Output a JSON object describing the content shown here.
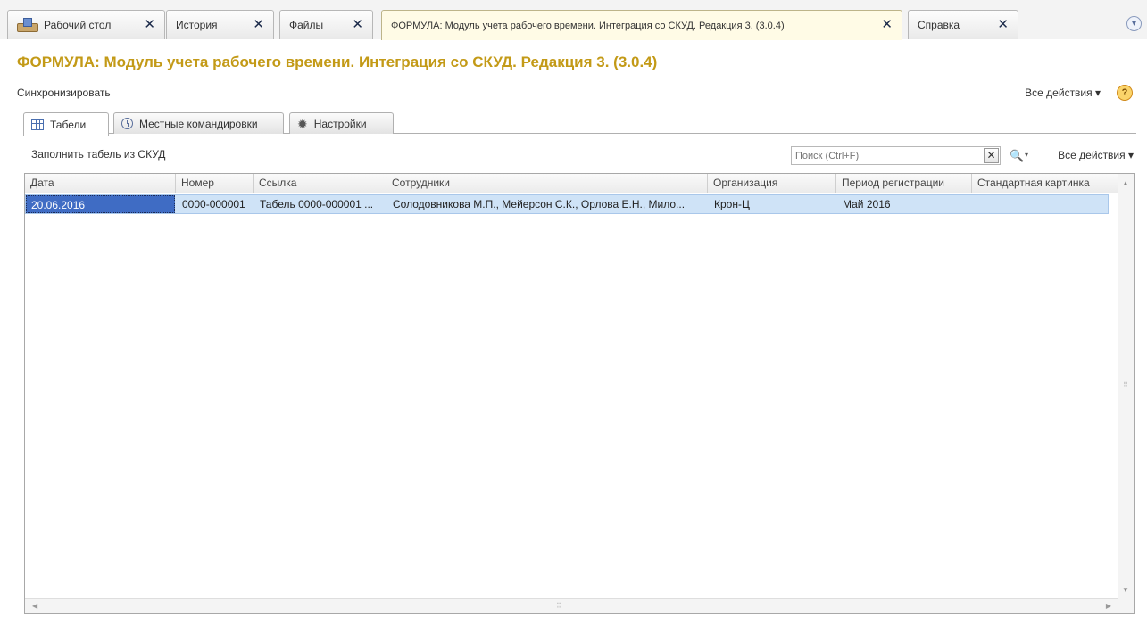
{
  "top_tabs": [
    {
      "label": "Рабочий стол",
      "close": "✕"
    },
    {
      "label": "История",
      "close": "✕"
    },
    {
      "label": "Файлы",
      "close": "✕"
    },
    {
      "label": "ФОРМУЛА: Модуль учета рабочего времени. Интеграция со СКУД. Редакция 3. (3.0.4)",
      "close": "✕"
    },
    {
      "label": "Справка",
      "close": "✕"
    }
  ],
  "tabs_more_glyph": "▾",
  "page": {
    "title": "ФОРМУЛА: Модуль учета рабочего времени. Интеграция со СКУД. Редакция 3. (3.0.4)",
    "sync_label": "Синхронизировать",
    "all_actions_label": "Все действия ▾",
    "help_glyph": "?"
  },
  "inner_tabs": [
    {
      "label": "Табели",
      "icon": "table-icon"
    },
    {
      "label": "Местные командировки",
      "icon": "clock-icon"
    },
    {
      "label": "Настройки",
      "icon": "gear-icon"
    }
  ],
  "toolbar": {
    "fill_label": "Заполнить табель из СКУД",
    "search_placeholder": "Поиск (Ctrl+F)",
    "search_value": "",
    "clear_glyph": "✕",
    "search_icon": "🔍",
    "caret": "▾",
    "all_actions_label": "Все действия ▾"
  },
  "table": {
    "columns": [
      "Дата",
      "Номер",
      "Ссылка",
      "Сотрудники",
      "Организация",
      "Период регистрации",
      "Стандартная картинка"
    ],
    "rows": [
      [
        "20.06.2016",
        "0000-000001",
        "Табель 0000-000001 ...",
        "Солодовникова М.П., Мейерсон С.К., Орлова Е.Н., Мило...",
        "Крон-Ц",
        "Май 2016",
        ""
      ]
    ]
  },
  "colors": {
    "title": "#c39a17",
    "selected_row": "#cfe3f7",
    "selected_cell": "#3f6cc4"
  }
}
